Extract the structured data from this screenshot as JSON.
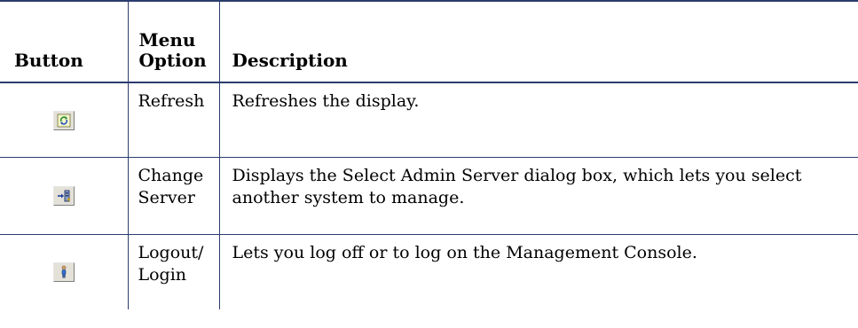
{
  "table": {
    "headers": {
      "button": "Button",
      "menu_option": "Menu Option",
      "description": "Description"
    },
    "rows": [
      {
        "icon": "refresh-icon",
        "menu_option": "Refresh",
        "description": "Refreshes the display."
      },
      {
        "icon": "change-server-icon",
        "menu_option": "Change Server",
        "description": "Displays the Select Admin Server dialog box, which lets you select another system to manage."
      },
      {
        "icon": "logout-login-icon",
        "menu_option": "Logout/ Login",
        "description": "Lets you log off or to log on the Management Console."
      }
    ]
  },
  "colors": {
    "rule": "#2b3c6e",
    "button_face": "#e4e1d9"
  }
}
